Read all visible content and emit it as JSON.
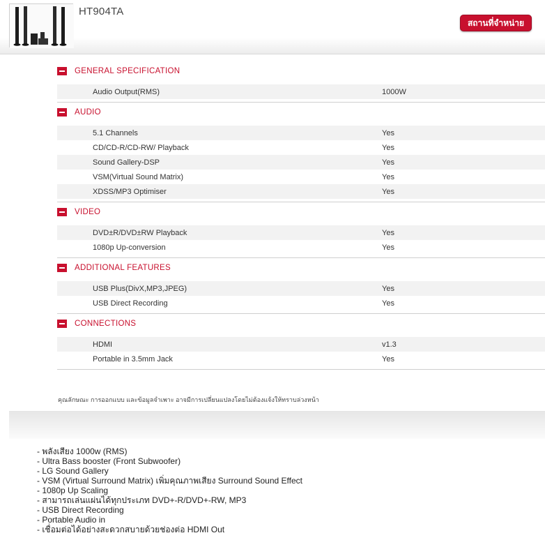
{
  "header": {
    "model": "HT904TA",
    "where_to_buy_label": "สถานที่จำหน่าย",
    "image_alt": "Home theater system with tall speakers"
  },
  "sections": [
    {
      "title": "GENERAL SPECIFICATION",
      "rows": [
        {
          "label": "Audio Output(RMS)",
          "value": "1000W"
        }
      ]
    },
    {
      "title": "AUDIO",
      "rows": [
        {
          "label": "5.1 Channels",
          "value": "Yes"
        },
        {
          "label": "CD/CD-R/CD-RW/ Playback",
          "value": "Yes"
        },
        {
          "label": "Sound Gallery-DSP",
          "value": "Yes"
        },
        {
          "label": "VSM(Virtual Sound Matrix)",
          "value": "Yes"
        },
        {
          "label": "XDSS/MP3 Optimiser",
          "value": "Yes"
        }
      ]
    },
    {
      "title": "VIDEO",
      "rows": [
        {
          "label": "DVD±R/DVD±RW Playback",
          "value": "Yes"
        },
        {
          "label": "1080p Up-conversion",
          "value": "Yes"
        }
      ]
    },
    {
      "title": "ADDITIONAL FEATURES",
      "rows": [
        {
          "label": "USB Plus(DivX,MP3,JPEG)",
          "value": "Yes"
        },
        {
          "label": "USB Direct Recording",
          "value": "Yes"
        }
      ]
    },
    {
      "title": "CONNECTIONS",
      "rows": [
        {
          "label": "HDMI",
          "value": "v1.3"
        },
        {
          "label": "Portable in 3.5mm Jack",
          "value": "Yes"
        }
      ]
    }
  ],
  "disclaimer": "คุณลักษณะ การออกแบบ และข้อมูลจำเพาะ อาจมีการเปลี่ยนแปลงโดยไม่ต้องแจ้งให้ทราบล่วงหน้า",
  "features": [
    "- พลังเสียง 1000w (RMS)",
    "- Ultra Bass booster (Front Subwoofer)",
    "- LG Sound Gallery",
    "- VSM (Virtual Surround Matrix) เพิ่มคุณภาพเสียง Surround Sound Effect",
    "- 1080p Up Scaling",
    "- สามารถเล่นแผ่นได้ทุกประเภท DVD+-R/DVD+-RW, MP3",
    "- USB Direct Recording",
    "- Portable Audio in",
    "- เชื่อมต่อได้อย่างสะดวกสบายด้วยช่องต่อ HDMI Out"
  ],
  "colors": {
    "accent": "#c8102e",
    "row_alt": "#f2f2f2"
  }
}
